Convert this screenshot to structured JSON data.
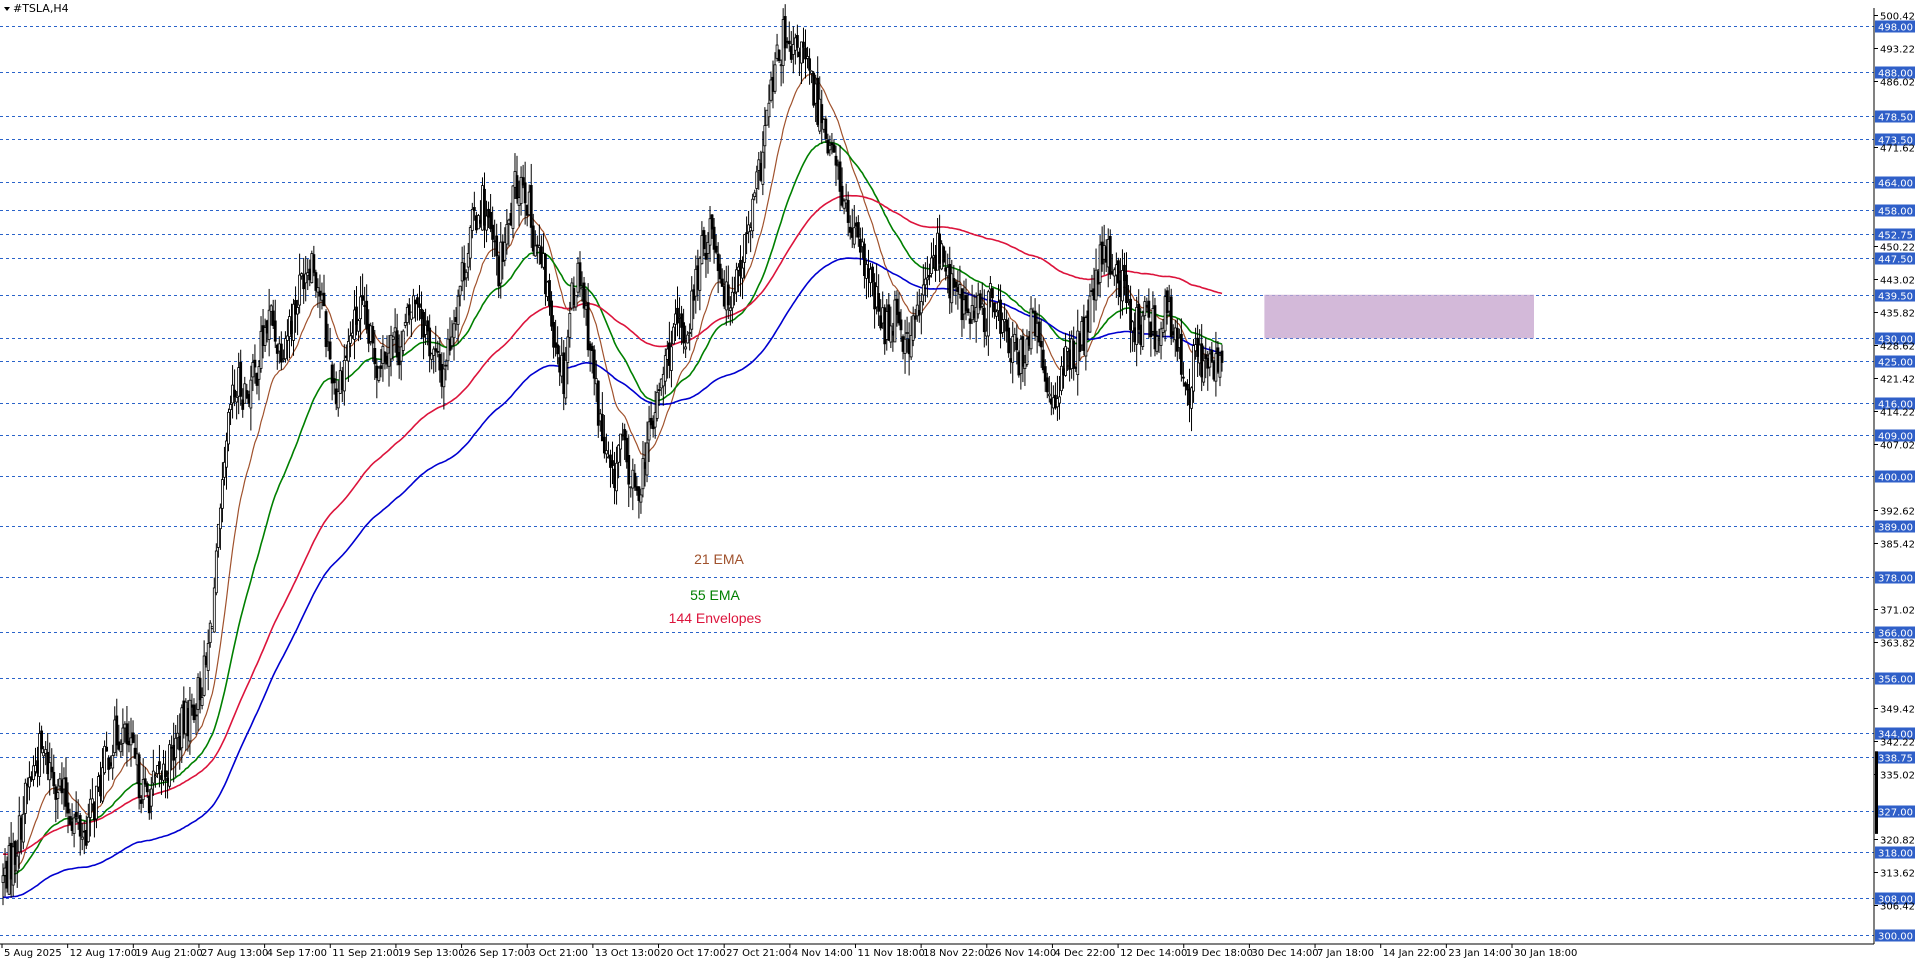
{
  "window": {
    "title": "#TSLA,H4"
  },
  "colors": {
    "background": "#ffffff",
    "grid": "#2a63c9",
    "candle": "#000000",
    "ema21": "#a0522d",
    "ema55": "#008000",
    "envelope144": "#dc143c",
    "envelope_lower": "#0000d0",
    "zone": "#c8a8d0",
    "price_tag": "#2f5fc8",
    "price_tag_text": "#ffffff"
  },
  "chart_data": {
    "type": "candlestick",
    "title": "#TSLA,H4",
    "ylim": [
      298,
      502
    ],
    "grid": true,
    "price_scale_labels": [
      "500.42",
      "493.22",
      "486.02",
      "471.62",
      "450.22",
      "443.02",
      "435.82",
      "428.62",
      "421.42",
      "414.22",
      "407.02",
      "392.62",
      "385.42",
      "371.02",
      "363.82",
      "349.42",
      "342.22",
      "335.02",
      "320.82",
      "313.62",
      "306.42"
    ],
    "horizontal_levels": [
      498.0,
      488.0,
      478.5,
      473.5,
      464.0,
      458.0,
      452.75,
      447.5,
      439.5,
      430.0,
      425.0,
      416.0,
      409.0,
      400.0,
      389.0,
      378.0,
      366.0,
      356.0,
      344.0,
      338.75,
      327.0,
      318.0,
      308.0,
      300.0
    ],
    "x_tick_labels": [
      "5 Aug 2025",
      "12 Aug 17:00",
      "19 Aug 21:00",
      "27 Aug 13:00",
      "4 Sep 17:00",
      "11 Sep 21:00",
      "19 Sep 13:00",
      "26 Sep 17:00",
      "3 Oct 21:00",
      "13 Oct 13:00",
      "20 Oct 17:00",
      "27 Oct 21:00",
      "4 Nov 14:00",
      "11 Nov 18:00",
      "18 Nov 22:00",
      "26 Nov 14:00",
      "4 Dec 22:00",
      "12 Dec 14:00",
      "19 Dec 18:00",
      "30 Dec 14:00",
      "7 Jan 18:00",
      "14 Jan 22:00",
      "23 Jan 14:00",
      "30 Jan 18:00"
    ],
    "close_anchors": [
      [
        0,
        312
      ],
      [
        6,
        318
      ],
      [
        12,
        332
      ],
      [
        18,
        340
      ],
      [
        24,
        336
      ],
      [
        30,
        330
      ],
      [
        35,
        325
      ],
      [
        40,
        322
      ],
      [
        46,
        330
      ],
      [
        52,
        340
      ],
      [
        58,
        345
      ],
      [
        64,
        338
      ],
      [
        70,
        330
      ],
      [
        76,
        333
      ],
      [
        82,
        338
      ],
      [
        88,
        345
      ],
      [
        94,
        350
      ],
      [
        100,
        358
      ],
      [
        104,
        375
      ],
      [
        108,
        395
      ],
      [
        112,
        415
      ],
      [
        116,
        420
      ],
      [
        120,
        418
      ],
      [
        124,
        422
      ],
      [
        128,
        430
      ],
      [
        132,
        435
      ],
      [
        136,
        428
      ],
      [
        140,
        432
      ],
      [
        144,
        437
      ],
      [
        148,
        445
      ],
      [
        152,
        448
      ],
      [
        156,
        440
      ],
      [
        160,
        428
      ],
      [
        164,
        418
      ],
      [
        168,
        425
      ],
      [
        172,
        432
      ],
      [
        176,
        436
      ],
      [
        180,
        430
      ],
      [
        184,
        425
      ],
      [
        188,
        428
      ],
      [
        192,
        430
      ],
      [
        196,
        428
      ],
      [
        200,
        435
      ],
      [
        204,
        440
      ],
      [
        208,
        432
      ],
      [
        212,
        426
      ],
      [
        216,
        422
      ],
      [
        220,
        430
      ],
      [
        224,
        440
      ],
      [
        228,
        448
      ],
      [
        232,
        456
      ],
      [
        236,
        460
      ],
      [
        240,
        452
      ],
      [
        244,
        445
      ],
      [
        248,
        452
      ],
      [
        252,
        462
      ],
      [
        256,
        466
      ],
      [
        260,
        455
      ],
      [
        264,
        448
      ],
      [
        268,
        440
      ],
      [
        272,
        430
      ],
      [
        276,
        422
      ],
      [
        280,
        440
      ],
      [
        284,
        445
      ],
      [
        288,
        432
      ],
      [
        292,
        418
      ],
      [
        296,
        405
      ],
      [
        300,
        398
      ],
      [
        304,
        408
      ],
      [
        308,
        400
      ],
      [
        312,
        395
      ],
      [
        316,
        405
      ],
      [
        320,
        412
      ],
      [
        324,
        420
      ],
      [
        328,
        428
      ],
      [
        332,
        432
      ],
      [
        336,
        430
      ],
      [
        340,
        440
      ],
      [
        344,
        448
      ],
      [
        348,
        455
      ],
      [
        352,
        448
      ],
      [
        356,
        438
      ],
      [
        360,
        443
      ],
      [
        364,
        448
      ],
      [
        368,
        455
      ],
      [
        372,
        465
      ],
      [
        376,
        478
      ],
      [
        380,
        488
      ],
      [
        384,
        495
      ],
      [
        388,
        490
      ],
      [
        392,
        494
      ],
      [
        396,
        488
      ],
      [
        400,
        482
      ],
      [
        404,
        478
      ],
      [
        408,
        470
      ],
      [
        412,
        464
      ],
      [
        416,
        455
      ],
      [
        420,
        450
      ],
      [
        424,
        446
      ],
      [
        428,
        440
      ],
      [
        432,
        434
      ],
      [
        436,
        432
      ],
      [
        440,
        438
      ],
      [
        444,
        428
      ],
      [
        448,
        432
      ],
      [
        452,
        438
      ],
      [
        456,
        444
      ],
      [
        460,
        450
      ],
      [
        464,
        445
      ],
      [
        468,
        440
      ],
      [
        472,
        438
      ],
      [
        476,
        434
      ],
      [
        480,
        436
      ],
      [
        484,
        435
      ],
      [
        488,
        440
      ],
      [
        492,
        432
      ],
      [
        496,
        428
      ],
      [
        500,
        425
      ],
      [
        504,
        430
      ],
      [
        508,
        434
      ],
      [
        512,
        422
      ],
      [
        516,
        418
      ],
      [
        520,
        420
      ],
      [
        524,
        425
      ],
      [
        528,
        428
      ],
      [
        532,
        430
      ],
      [
        536,
        438
      ],
      [
        540,
        446
      ],
      [
        544,
        448
      ],
      [
        548,
        445
      ],
      [
        552,
        440
      ],
      [
        556,
        434
      ],
      [
        560,
        432
      ],
      [
        564,
        436
      ],
      [
        568,
        430
      ],
      [
        572,
        438
      ],
      [
        576,
        430
      ],
      [
        580,
        425
      ],
      [
        584,
        420
      ],
      [
        588,
        428
      ],
      [
        592,
        424
      ],
      [
        596,
        422
      ],
      [
        600,
        428
      ]
    ],
    "zone": {
      "x_from": "30 Dec 14:00",
      "x_to": "30 Jan 18:00",
      "price_low": 430.0,
      "price_high": 439.5
    },
    "series": [
      {
        "name": "21 EMA",
        "period": 21,
        "kind": "ema",
        "color_key": "ema21"
      },
      {
        "name": "55 EMA",
        "period": 55,
        "kind": "ema",
        "color_key": "ema55"
      },
      {
        "name": "144 Envelopes",
        "period": 144,
        "kind": "envelope",
        "color_key": "envelope144"
      },
      {
        "name": "",
        "period": 144,
        "kind": "envelope_lower",
        "color_key": "envelope_lower"
      }
    ],
    "last_price": 425.0
  },
  "legend": [
    {
      "label": "21 EMA",
      "color_key": "ema21"
    },
    {
      "label": "55 EMA",
      "color_key": "ema55"
    },
    {
      "label": "144 Envelopes",
      "color_key": "envelope144"
    }
  ]
}
